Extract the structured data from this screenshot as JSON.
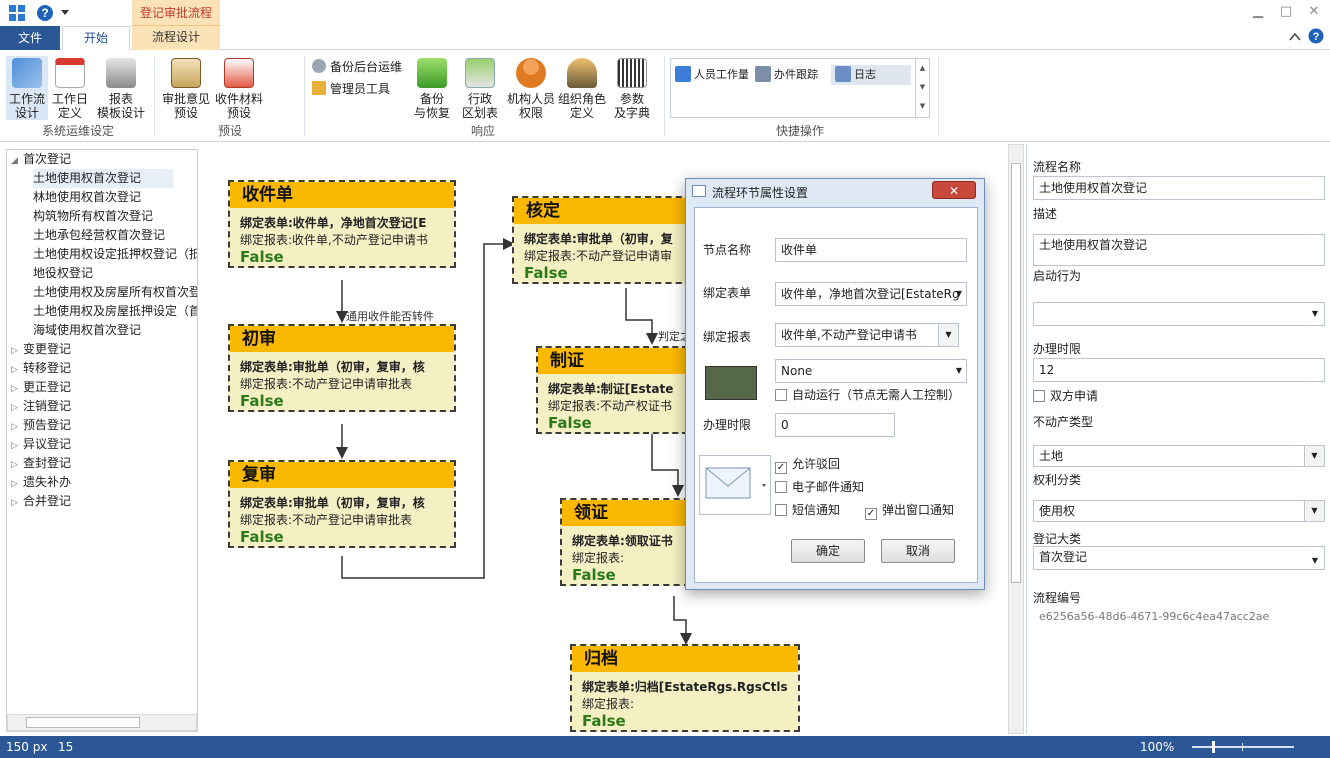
{
  "titlebar": {
    "context_tab": "登记审批流程",
    "icons": [
      "app-grid-icon",
      "help-circle-icon",
      "dropdown-arrow-icon"
    ]
  },
  "tabs": {
    "file": "文件",
    "home": "开始",
    "flow_design": "流程设计"
  },
  "ribbon": {
    "group1": {
      "label": "系统运维设定",
      "buttons": [
        {
          "line1": "工作流",
          "line2": "设计"
        },
        {
          "line1": "工作日",
          "line2": "定义"
        },
        {
          "line1": "报表",
          "line2": "模板设计"
        }
      ]
    },
    "group2": {
      "label": "预设",
      "buttons": [
        {
          "line1": "审批意见",
          "line2": "预设"
        },
        {
          "line1": "收件材料",
          "line2": "预设"
        }
      ]
    },
    "group3": {
      "label": "响应",
      "small_buttons": [
        "备份后台运维",
        "管理员工具"
      ],
      "buttons": [
        {
          "line1": "备份",
          "line2": "与恢复"
        },
        {
          "line1": "行政",
          "line2": "区划表"
        },
        {
          "line1": "机构人员",
          "line2": "权限"
        },
        {
          "line1": "组织角色",
          "line2": "定义"
        },
        {
          "line1": "参数",
          "line2": "及字典"
        }
      ]
    },
    "group4": {
      "label": "快捷操作",
      "gallery": [
        "人员工作量",
        "办件跟踪",
        "日志"
      ]
    }
  },
  "tree": {
    "root": "首次登记",
    "children": [
      "土地使用权首次登记",
      "林地使用权首次登记",
      "构筑物所有权首次登记",
      "土地承包经营权首次登记",
      "土地使用权设定抵押权登记（抵",
      "地役权登记",
      "土地使用权及房屋所有权首次登",
      "土地使用权及房屋抵押设定（首",
      "海域使用权首次登记"
    ],
    "collapsed": [
      "变更登记",
      "转移登记",
      "更正登记",
      "注销登记",
      "预告登记",
      "异议登记",
      "查封登记",
      "遗失补办",
      "合并登记"
    ]
  },
  "flow": {
    "nodes": {
      "shoujian": {
        "title": "收件单",
        "form": "绑定表单:收件单，净地首次登记[E",
        "report": "绑定报表:收件单,不动产登记申请书",
        "flag": "False"
      },
      "chushen": {
        "title": "初审",
        "form": "绑定表单:审批单（初审，复审，核",
        "report": "绑定报表:不动产登记申请审批表",
        "flag": "False"
      },
      "fushen": {
        "title": "复审",
        "form": "绑定表单:审批单（初审，复审，核",
        "report": "绑定报表:不动产登记申请审批表",
        "flag": "False"
      },
      "heding": {
        "title": "核定",
        "form": "绑定表单:审批单（初审，复",
        "report": "绑定报表:不动产登记申请审",
        "flag": "False"
      },
      "zhizheng": {
        "title": "制证",
        "form": "绑定表单:制证[Estate",
        "report": "绑定报表:不动产权证书",
        "flag": "False"
      },
      "lingzheng": {
        "title": "领证",
        "form": "绑定表单:领取证书",
        "report": "绑定报表:",
        "flag": "False"
      },
      "guidang": {
        "title": "归档",
        "form": "绑定表单:归档[EstateRgs.RgsCtls",
        "report": "绑定报表:",
        "flag": "False"
      }
    },
    "edge_labels": {
      "e1": "通用收件能否转件",
      "e2": "判定之"
    }
  },
  "dialog": {
    "title": "流程环节属性设置",
    "node_name_label": "节点名称",
    "node_name": "收件单",
    "form_label": "绑定表单",
    "form_value": "收件单，净地首次登记[EstateRg",
    "report_label": "绑定报表",
    "report_value": "收件单,不动产登记申请书",
    "color_select": "None",
    "color": "#55694a",
    "auto_run": "自动运行（节点无需人工控制）",
    "time_label": "办理时限",
    "time_value": "0",
    "opt_return": "允许驳回",
    "opt_email": "电子邮件通知",
    "opt_sms": "短信通知",
    "opt_popup": "弹出窗口通知",
    "ok": "确定",
    "cancel": "取消"
  },
  "props": {
    "name_label": "流程名称",
    "name_value": "土地使用权首次登记",
    "desc_label": "描述",
    "desc_value": "土地使用权首次登记",
    "start_label": "启动行为",
    "start_value": "",
    "limit_label": "办理时限",
    "limit_value": "12",
    "dual_label": "双方申请",
    "type_label": "不动产类型",
    "type_value": "土地",
    "rights_label": "权利分类",
    "rights_value": "使用权",
    "category_label": "登记大类",
    "category_value": "首次登记",
    "id_label": "流程编号",
    "id_value": "e6256a56-48d6-4671-99c6c4ea47acc2ae"
  },
  "status": {
    "left1": "150 px",
    "left2": "15",
    "zoom": "100%",
    "zoom_level": 0.2
  }
}
